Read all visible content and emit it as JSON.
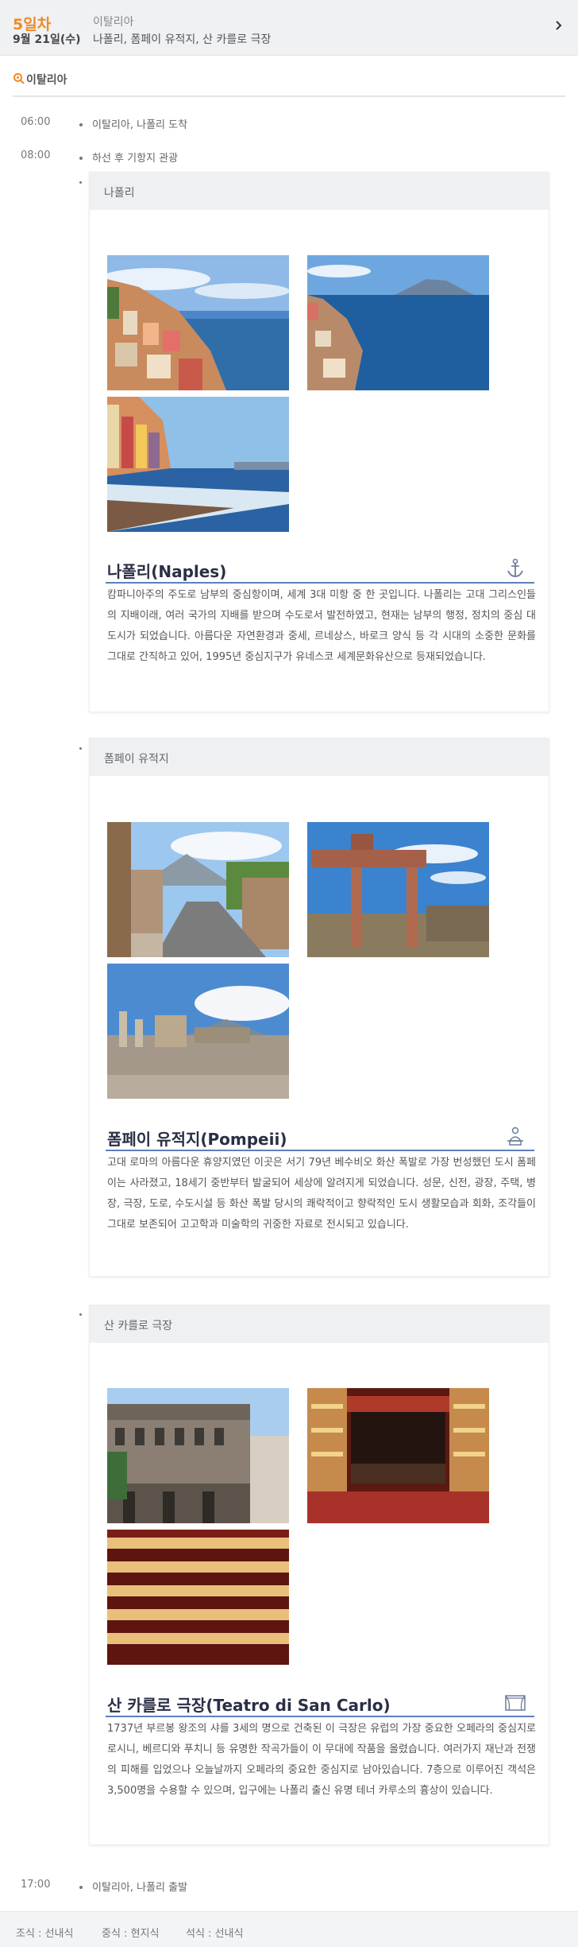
{
  "day": {
    "label": "5일차",
    "date": "9월 21일(수)",
    "country": "이탈리아",
    "places": "나폴리, 폼페이 유적지, 산 카를로 극장",
    "chevron_icon": "chevron-right-icon"
  },
  "region": {
    "icon": "search-pin-icon",
    "label": "이탈리아"
  },
  "schedule": [
    {
      "time": "06:00",
      "text": "이탈리아, 나폴리 도착"
    },
    {
      "time": "08:00",
      "text": "하선 후 기항지 관광"
    },
    {
      "time": "17:00",
      "text": "이탈리아, 나폴리 출발"
    }
  ],
  "places": [
    {
      "header": "나폴리",
      "title": "나폴리(Naples)",
      "icon": "anchor-icon",
      "description": "캄파니아주의 주도로 남부의 중심항이며, 세계 3대 미항 중 한 곳입니다. 나폴리는 고대 그리스인들의 지배이래, 여러 국가의 지배를 받으며 수도로서 발전하였고, 현재는 남부의 행정, 정치의 중심 대도시가 되었습니다. 아름다운 자연환경과 중세, 르네상스, 바로크 양식 등 각 시대의 소중한 문화를 그대로 간직하고 있어, 1995년 중심지구가 유네스코 세계문화유산으로 등재되었습니다."
    },
    {
      "header": "폼페이 유적지",
      "title": "폼페이 유적지(Pompeii)",
      "icon": "ruins-statue-icon",
      "description": "고대 로마의 아름다운 휴양지였던 이곳은 서기 79년 베수비오 화산 폭발로 가장 번성했던 도시 폼페이는 사라졌고, 18세기 중반부터 발굴되어 세상에 알려지게 되었습니다. 성문, 신전, 광장, 주택, 병장, 극장, 도로, 수도시설 등 화산 폭발 당시의 쾌락적이고 향락적인 도시 생활모습과 회화, 조각들이 그대로 보존되어 고고학과 미술학의 귀중한 자료로 전시되고 있습니다."
    },
    {
      "header": "산 카를로 극장",
      "title": "산 카를로 극장(Teatro di San Carlo)",
      "icon": "theater-icon",
      "description": "1737년 부르봉 왕조의 샤를 3세의 명으로 건축된 이 극장은 유럽의 가장 중요한 오페라의 중심지로 로시니, 베르디와 푸치니 등 유명한 작곡가들이 이 무대에 작품을 올렸습니다. 여러가지 재난과 전쟁의 피해를 입었으나 오늘날까지 오페라의 중요한 중심지로 남아있습니다. 7층으로 이루어진 객석은 3,500명을 수용할 수 있으며, 입구에는 나폴리 출신 유명 테너 카루소의 흉상이 있습니다."
    }
  ],
  "meals": {
    "breakfast": "조식 : 선내식",
    "lunch": "중식 : 현지식",
    "dinner": "석식 : 선내식"
  }
}
